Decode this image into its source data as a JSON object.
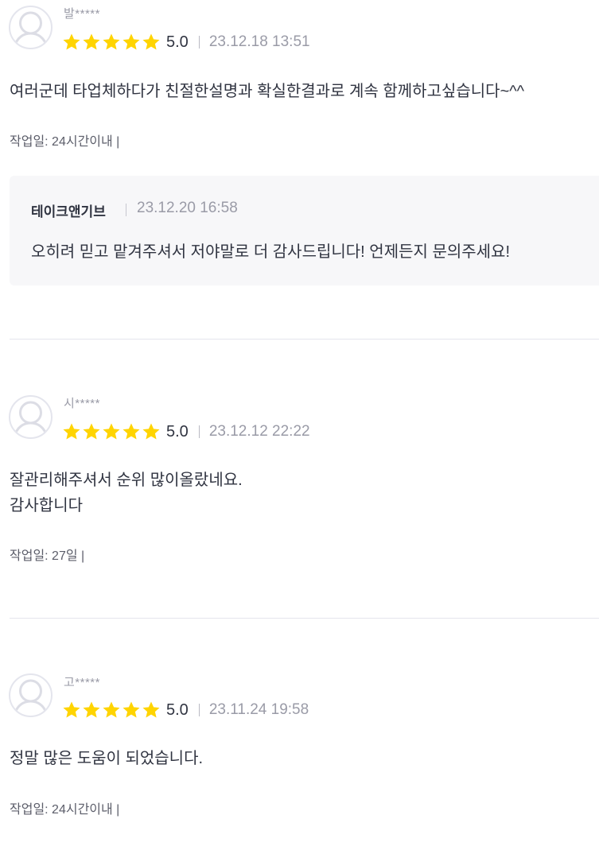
{
  "colors": {
    "star": "#ffd400",
    "text": "#303441",
    "muted": "#9a9ba7",
    "reply_bg": "#f7f7f9",
    "divider": "#e4e5ed"
  },
  "reviews": [
    {
      "username": "발*****",
      "stars": 5,
      "score": "5.0",
      "date": "23.12.18 13:51",
      "body": "여러군데 타업체하다가 친절한설명과 확실한결과로 계속 함께하고싶습니다~^^",
      "meta": "작업일: 24시간이내 |",
      "reply": {
        "author": "테이크앤기브",
        "date": "23.12.20 16:58",
        "text": "오히려 믿고 맡겨주셔서 저야말로 더 감사드립니다! 언제든지 문의주세요!"
      }
    },
    {
      "username": "시*****",
      "stars": 5,
      "score": "5.0",
      "date": "23.12.12 22:22",
      "body": "잘관리해주셔서 순위 많이올랐네요.\n감사합니다",
      "meta": "작업일: 27일 |"
    },
    {
      "username": "고*****",
      "stars": 5,
      "score": "5.0",
      "date": "23.11.24 19:58",
      "body": "정말 많은 도움이 되었습니다.",
      "meta": "작업일: 24시간이내 |"
    }
  ]
}
